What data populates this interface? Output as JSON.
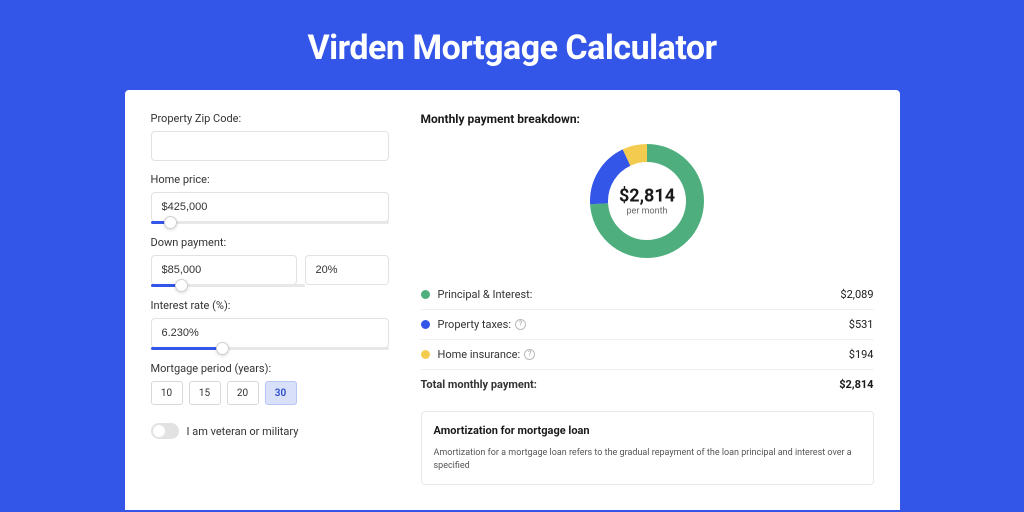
{
  "title": "Virden Mortgage Calculator",
  "form": {
    "zip_label": "Property Zip Code:",
    "zip_value": "",
    "home_price_label": "Home price:",
    "home_price_value": "$425,000",
    "home_price_slider_pct": 8,
    "down_payment_label": "Down payment:",
    "down_payment_value": "$85,000",
    "down_payment_pct_value": "20%",
    "down_payment_slider_pct": 20,
    "interest_label": "Interest rate (%):",
    "interest_value": "6.230%",
    "interest_slider_pct": 30,
    "period_label": "Mortgage period (years):",
    "periods": [
      "10",
      "15",
      "20",
      "30"
    ],
    "period_active": 3,
    "veteran_label": "I am veteran or military"
  },
  "breakdown": {
    "heading": "Monthly payment breakdown:",
    "donut_value": "$2,814",
    "donut_sub": "per month",
    "rows": [
      {
        "label": "Principal & Interest:",
        "value": "$2,089",
        "color": "#4eae7e",
        "help": false
      },
      {
        "label": "Property taxes:",
        "value": "$531",
        "color": "#3355e8",
        "help": true
      },
      {
        "label": "Home insurance:",
        "value": "$194",
        "color": "#f3cc4f",
        "help": true
      }
    ],
    "total_label": "Total monthly payment:",
    "total_value": "$2,814"
  },
  "amortization": {
    "heading": "Amortization for mortgage loan",
    "text": "Amortization for a mortgage loan refers to the gradual repayment of the loan principal and interest over a specified"
  },
  "chart_data": {
    "type": "pie",
    "title": "Monthly payment breakdown",
    "series": [
      {
        "name": "Principal & Interest",
        "value": 2089,
        "color": "#4eae7e"
      },
      {
        "name": "Property taxes",
        "value": 531,
        "color": "#3355e8"
      },
      {
        "name": "Home insurance",
        "value": 194,
        "color": "#f3cc4f"
      }
    ],
    "total": 2814,
    "center_label": "$2,814 per month"
  }
}
